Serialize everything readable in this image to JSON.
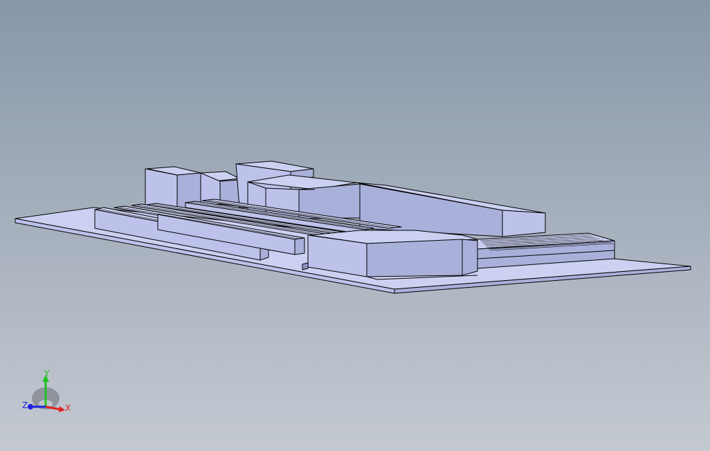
{
  "viewport": {
    "background_top": "#8797aa",
    "background_bottom": "#c4c9d1"
  },
  "model": {
    "face_color": "#ccd1f2",
    "edge_color": "#000000"
  },
  "triad": {
    "x_label": "X",
    "y_label": "Y",
    "z_label": "Z",
    "x_color": "#e02020",
    "y_color": "#20c020",
    "z_color": "#2020e0"
  }
}
